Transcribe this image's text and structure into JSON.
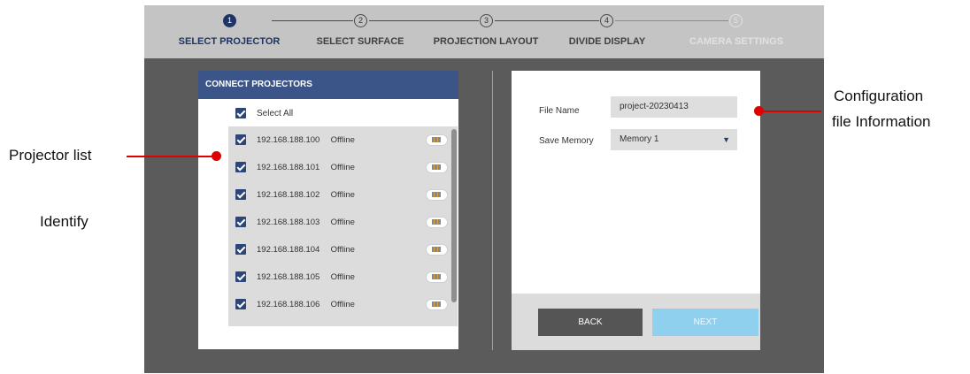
{
  "stepper": {
    "steps": [
      {
        "number": "1",
        "label": "SELECT PROJECTOR",
        "state": "active"
      },
      {
        "number": "2",
        "label": "SELECT SURFACE",
        "state": "normal"
      },
      {
        "number": "3",
        "label": "PROJECTION LAYOUT",
        "state": "normal"
      },
      {
        "number": "4",
        "label": "DIVIDE DISPLAY",
        "state": "normal"
      },
      {
        "number": "5",
        "label": "CAMERA SETTINGS",
        "state": "disabled"
      }
    ]
  },
  "connect_panel": {
    "header": "CONNECT PROJECTORS",
    "select_all_label": "Select All",
    "select_all_checked": true,
    "projectors": [
      {
        "ip": "192.168.188.100",
        "status": "Offline",
        "checked": true
      },
      {
        "ip": "192.168.188.101",
        "status": "Offline",
        "checked": true
      },
      {
        "ip": "192.168.188.102",
        "status": "Offline",
        "checked": true
      },
      {
        "ip": "192.168.188.103",
        "status": "Offline",
        "checked": true
      },
      {
        "ip": "192.168.188.104",
        "status": "Offline",
        "checked": true
      },
      {
        "ip": "192.168.188.105",
        "status": "Offline",
        "checked": true
      },
      {
        "ip": "192.168.188.106",
        "status": "Offline",
        "checked": true
      }
    ],
    "identify_icon": "identify-projector-icon"
  },
  "config_panel": {
    "file_name_label": "File Name",
    "file_name_value": "project-20230413",
    "save_memory_label": "Save Memory",
    "save_memory_value": "Memory 1",
    "back_label": "BACK",
    "next_label": "NEXT"
  },
  "annotations": {
    "projector_list": "Projector list",
    "identify": "Identify",
    "config_line1": "Configuration",
    "config_line2": "file Information"
  },
  "colors": {
    "accent": "#1e3464",
    "header": "#3b5588",
    "annotation": "#e00000",
    "next_button": "#8fd0ef"
  }
}
